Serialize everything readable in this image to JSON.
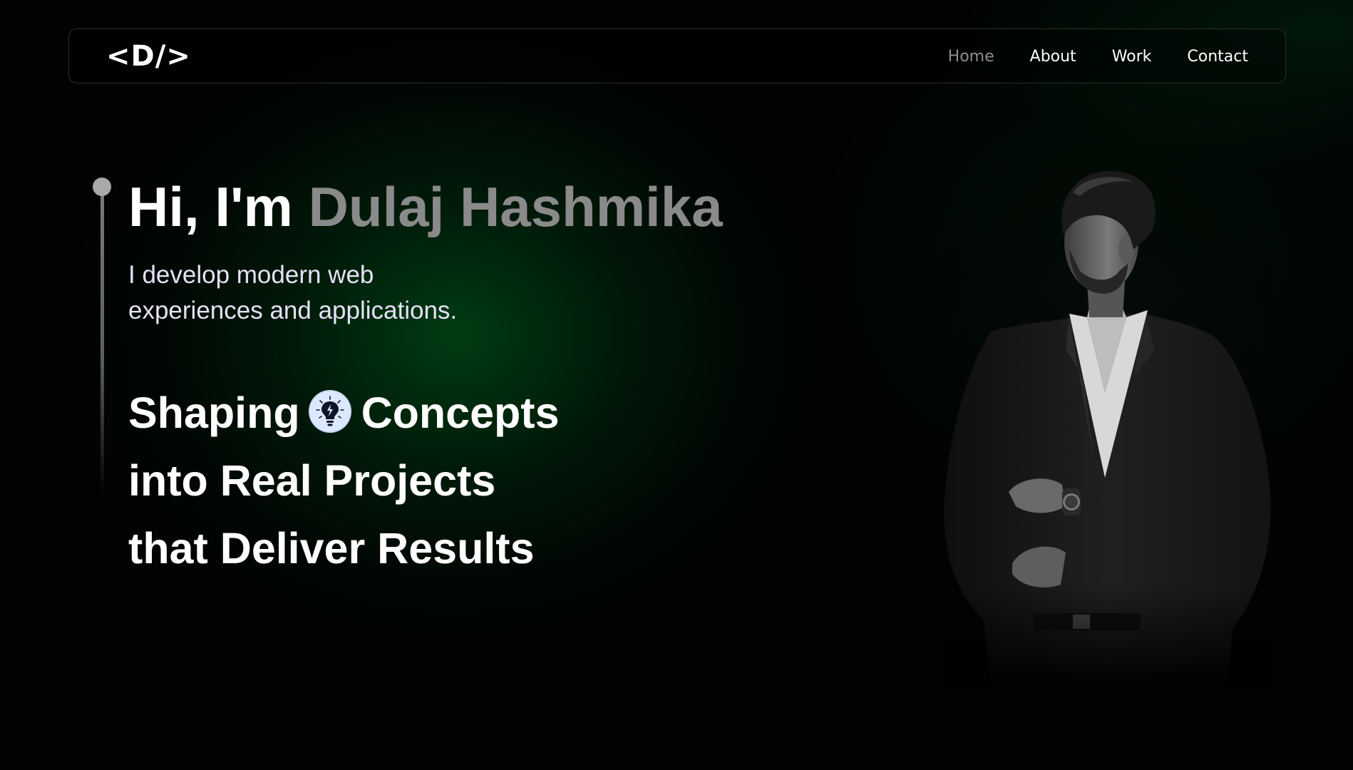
{
  "logo": "<D/>",
  "nav": {
    "items": [
      {
        "label": "Home",
        "active": true
      },
      {
        "label": "About",
        "active": false
      },
      {
        "label": "Work",
        "active": false
      },
      {
        "label": "Contact",
        "active": false
      }
    ]
  },
  "hero": {
    "greeting": "Hi, I'm",
    "name": "Dulaj Hashmika",
    "subtitle_line1": "I develop modern web",
    "subtitle_line2": "experiences and applications.",
    "tagline_word1": "Shaping",
    "tagline_icon": "lightbulb-icon",
    "tagline_word2": "Concepts",
    "tagline_line2": "into Real Projects",
    "tagline_line3": "that Deliver Results"
  },
  "portrait": {
    "icon": "portrait-photo",
    "style": "black-and-white"
  },
  "colors": {
    "background": "#010302",
    "glow": "#00461a",
    "accent_name": "#8a8a8a",
    "subtitle": "#e4e2f6",
    "nav_active": "#8f8f8f",
    "bulb_circle": "#dce8ff"
  }
}
